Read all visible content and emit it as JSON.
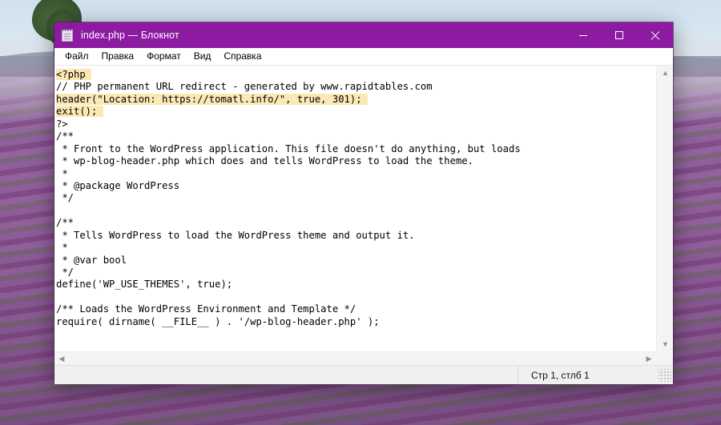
{
  "desktop": {
    "wallpaper_description": "lavender-field",
    "sky_color": "#d2e2ef",
    "field_color": "#8d5f9b"
  },
  "window": {
    "title": "index.php — Блокнот",
    "title_icon": "notepad-icon",
    "accent_color": "#8c1ba2",
    "controls": {
      "minimize": "minimize-icon",
      "maximize": "maximize-icon",
      "close": "close-icon"
    }
  },
  "menu": {
    "items": [
      {
        "label": "Файл"
      },
      {
        "label": "Правка"
      },
      {
        "label": "Формат"
      },
      {
        "label": "Вид"
      },
      {
        "label": "Справка"
      }
    ]
  },
  "editor": {
    "lines": [
      {
        "text": "<?php",
        "highlight": "full",
        "caret": true
      },
      {
        "text": "// PHP permanent URL redirect - generated by www.rapidtables.com",
        "highlight": "none"
      },
      {
        "text": "header(\"Location: https://tomatl.info/\", true, 301);",
        "highlight": "full"
      },
      {
        "text": "exit();",
        "highlight": "full"
      },
      {
        "text": "?>",
        "highlight": "none"
      },
      {
        "text": "/**",
        "highlight": "none"
      },
      {
        "text": " * Front to the WordPress application. This file doesn't do anything, but loads",
        "highlight": "none"
      },
      {
        "text": " * wp-blog-header.php which does and tells WordPress to load the theme.",
        "highlight": "none"
      },
      {
        "text": " *",
        "highlight": "none"
      },
      {
        "text": " * @package WordPress",
        "highlight": "none"
      },
      {
        "text": " */",
        "highlight": "none"
      },
      {
        "text": "",
        "highlight": "none"
      },
      {
        "text": "/**",
        "highlight": "none"
      },
      {
        "text": " * Tells WordPress to load the WordPress theme and output it.",
        "highlight": "none"
      },
      {
        "text": " *",
        "highlight": "none"
      },
      {
        "text": " * @var bool",
        "highlight": "none"
      },
      {
        "text": " */",
        "highlight": "none"
      },
      {
        "text": "define('WP_USE_THEMES', true);",
        "highlight": "none"
      },
      {
        "text": "",
        "highlight": "none"
      },
      {
        "text": "/** Loads the WordPress Environment and Template */",
        "highlight": "none"
      },
      {
        "text": "require( dirname( __FILE__ ) . '/wp-blog-header.php' );",
        "highlight": "none"
      }
    ],
    "highlight_color": "#fbe8b4",
    "scrollbars": {
      "vertical": {
        "up": "▲",
        "down": "▼"
      },
      "horizontal": {
        "left": "◀",
        "right": "▶"
      }
    }
  },
  "statusbar": {
    "position": "Стр 1, стлб 1",
    "grip": "resize-grip-icon"
  }
}
